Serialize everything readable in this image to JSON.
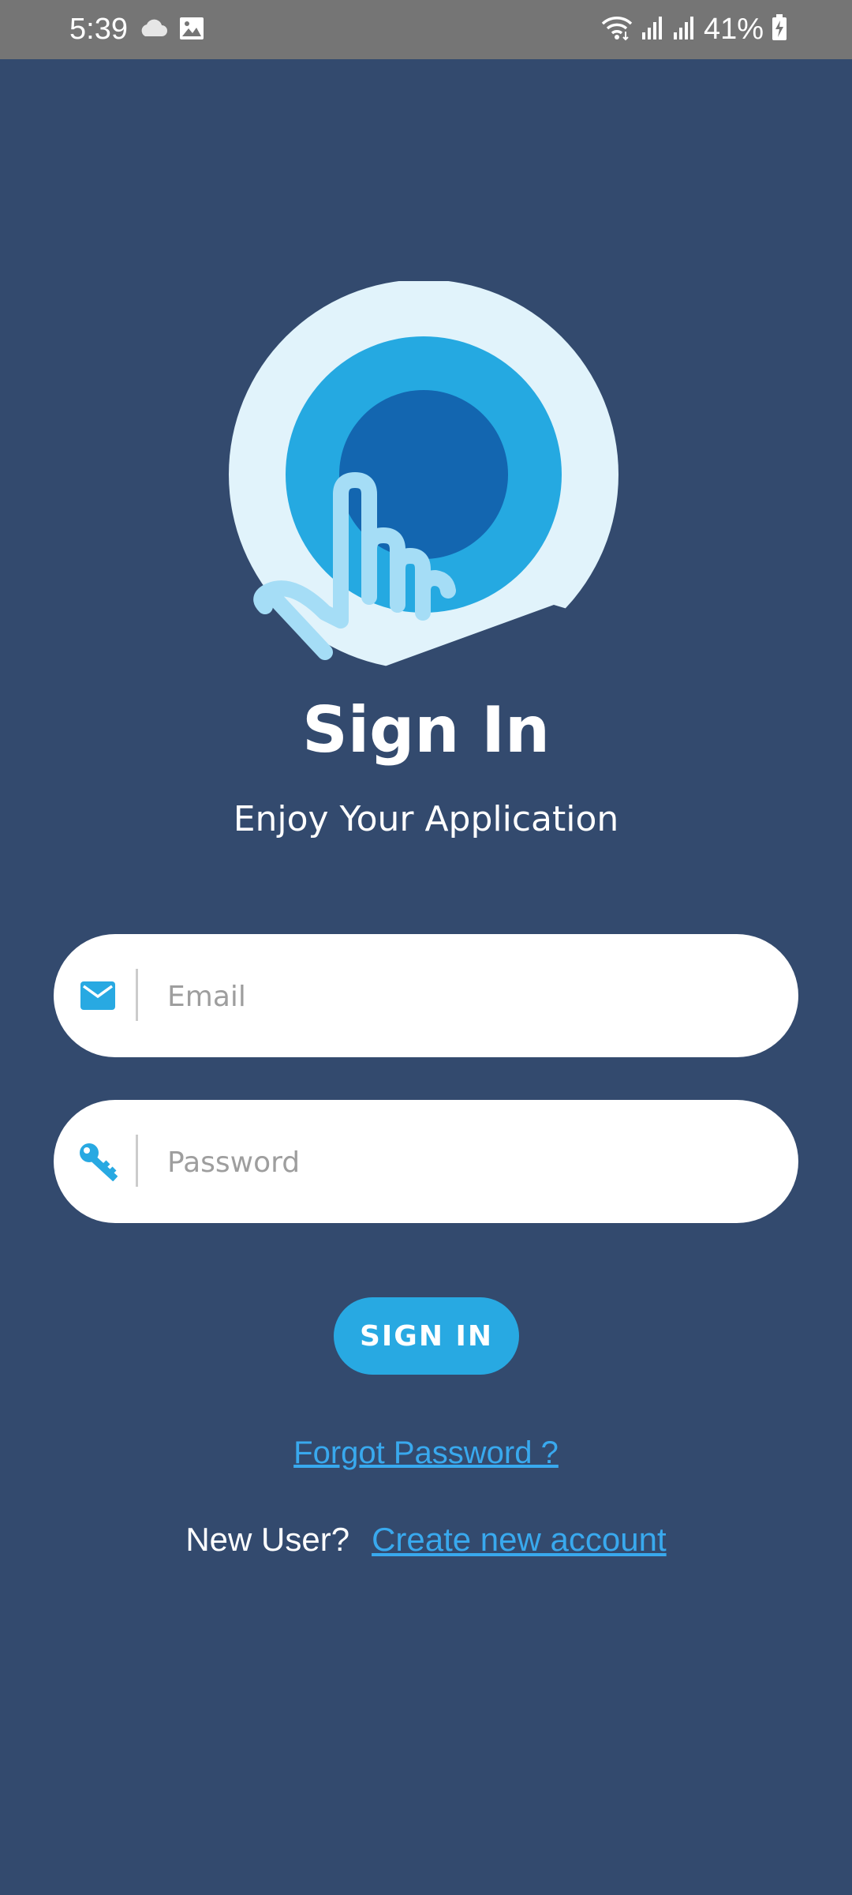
{
  "status_bar": {
    "time": "5:39",
    "battery": "41%",
    "icons": [
      "cloud-icon",
      "image-icon",
      "wifi-icon",
      "signal-icon",
      "signal-icon",
      "battery-charging-icon"
    ]
  },
  "header": {
    "title": "Sign In",
    "subtitle": "Enjoy Your Application"
  },
  "form": {
    "email_placeholder": "Email",
    "email_value": "",
    "password_placeholder": "Password",
    "password_value": "",
    "submit_label": "SIGN IN"
  },
  "links": {
    "forgot_password": "Forgot Password ?",
    "new_user_label": "New User?",
    "create_account": "Create new account"
  },
  "colors": {
    "background": "#334A6E",
    "status_bar": "#757575",
    "accent": "#28A9E2",
    "link": "#39A9EE",
    "logo_outer": "#E1F3FB",
    "logo_middle": "#25A9E1",
    "logo_inner": "#1366B0",
    "logo_hand": "#A5DDF6"
  }
}
